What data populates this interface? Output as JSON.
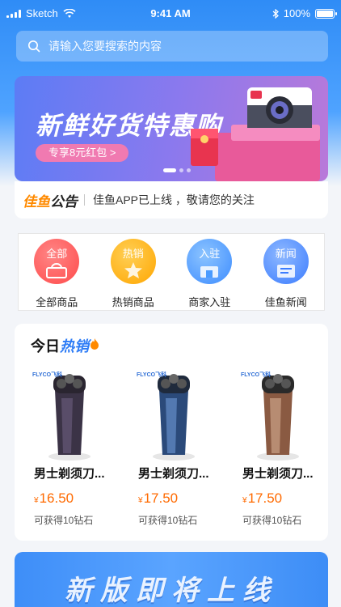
{
  "status": {
    "carrier": "Sketch",
    "time": "9:41 AM",
    "battery": "100%"
  },
  "search": {
    "placeholder": "请输入您要搜索的内容"
  },
  "banner": {
    "headline": "新鲜好货特惠购",
    "pill": "专享8元红包 >",
    "slides": 3,
    "active_slide": 1
  },
  "notice": {
    "brand_a": "佳鱼",
    "brand_b": "公告",
    "message": "佳鱼APP已上线 ，敬请您的关注"
  },
  "categories": [
    {
      "icon_text": "全部",
      "label": "全部商品",
      "icon": "shopping-bag-icon",
      "color": "#ff5a5a"
    },
    {
      "icon_text": "热销",
      "label": "热销商品",
      "icon": "hot-star-icon",
      "color": "#ffb21f"
    },
    {
      "icon_text": "入驻",
      "label": "商家入驻",
      "icon": "store-icon",
      "color": "#4a9bff"
    },
    {
      "icon_text": "新闻",
      "label": "佳鱼新闻",
      "icon": "news-icon",
      "color": "#4a8bff"
    }
  ],
  "hot": {
    "title_a": "今日",
    "title_b": "热销",
    "products": [
      {
        "brand": "FLYCO飞科",
        "name": "男士剃须刀...",
        "currency": "¥",
        "price": "16.50",
        "reward": "可获得10钻石",
        "color": "#3b3346"
      },
      {
        "brand": "FLYCO飞科",
        "name": "男士剃须刀...",
        "currency": "¥",
        "price": "17.50",
        "reward": "可获得10钻石",
        "color": "#2b4a7a"
      },
      {
        "brand": "FLYCO飞科",
        "name": "男士剃须刀...",
        "currency": "¥",
        "price": "17.50",
        "reward": "可获得10钻石",
        "color": "#8a5a42"
      }
    ]
  },
  "bottom_banner": {
    "text": "新版即将上线"
  },
  "colors": {
    "accent": "#2f8cf6",
    "price": "#ff6a00",
    "brand_orange": "#ff8a00"
  }
}
